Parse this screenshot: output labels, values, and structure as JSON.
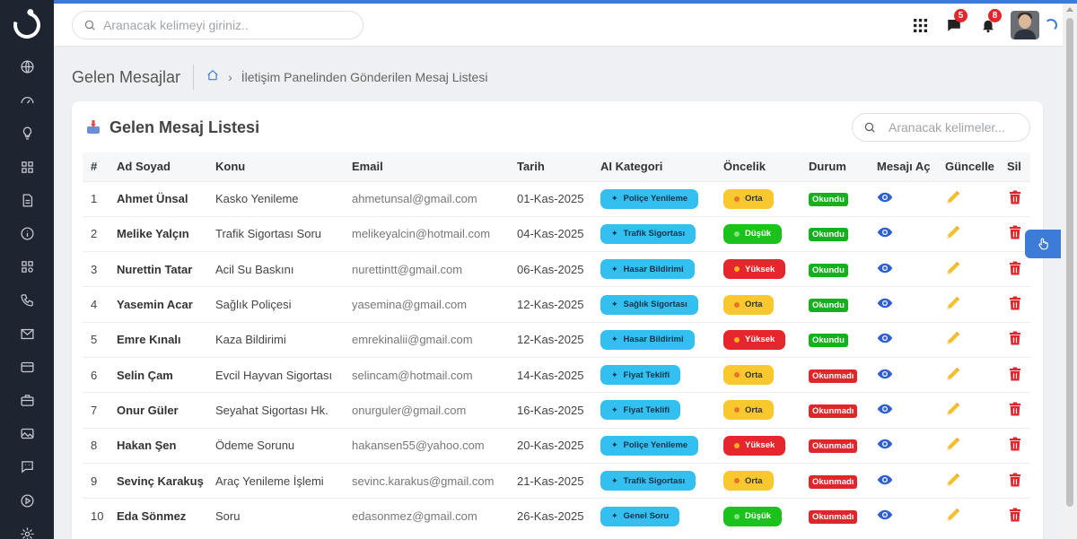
{
  "header": {
    "search_placeholder": "Aranacak kelimeyi giriniz..",
    "messages_count": "5",
    "notifications_count": "8"
  },
  "sidebar": {
    "items": [
      "globe-icon",
      "dashboard-icon",
      "lightbulb-icon",
      "grid-icon",
      "document-icon",
      "info-icon",
      "apps-icon",
      "phone-icon",
      "mail-icon",
      "card-icon",
      "briefcase-icon",
      "image-icon",
      "chat-icon",
      "play-icon",
      "settings-icon"
    ]
  },
  "page": {
    "title": "Gelen Mesajlar",
    "breadcrumb": "İletişim Panelinden Gönderilen Mesaj Listesi"
  },
  "card": {
    "title": "Gelen Mesaj Listesi",
    "search_placeholder": "Aranacak kelimeler...",
    "columns": [
      "#",
      "Ad Soyad",
      "Konu",
      "Email",
      "Tarih",
      "AI Kategori",
      "Öncelik",
      "Durum",
      "Mesajı Aç",
      "Güncelle",
      "Sil"
    ],
    "rows": [
      {
        "num": "1",
        "name": "Ahmet Ünsal",
        "subject": "Kasko Yenileme",
        "email": "ahmetunsal@gmail.com",
        "date": "01-Kas-2025",
        "category": "Poliçe Yenileme",
        "priority": "Orta",
        "status": "Okundu"
      },
      {
        "num": "2",
        "name": "Melike Yalçın",
        "subject": "Trafik Sigortası Soru",
        "email": "melikeyalcin@hotmail.com",
        "date": "04-Kas-2025",
        "category": "Trafik Sigortası",
        "priority": "Düşük",
        "status": "Okundu"
      },
      {
        "num": "3",
        "name": "Nurettin Tatar",
        "subject": "Acil Su Baskını",
        "email": "nurettintt@gmail.com",
        "date": "06-Kas-2025",
        "category": "Hasar Bildirimi",
        "priority": "Yüksek",
        "status": "Okundu"
      },
      {
        "num": "4",
        "name": "Yasemin Acar",
        "subject": "Sağlık Poliçesi",
        "email": "yasemina@gmail.com",
        "date": "12-Kas-2025",
        "category": "Sağlık Sigortası",
        "priority": "Orta",
        "status": "Okundu"
      },
      {
        "num": "5",
        "name": "Emre Kınalı",
        "subject": "Kaza Bildirimi",
        "email": "emrekinalii@gmail.com",
        "date": "12-Kas-2025",
        "category": "Hasar Bildirimi",
        "priority": "Yüksek",
        "status": "Okundu"
      },
      {
        "num": "6",
        "name": "Selin Çam",
        "subject": "Evcil Hayvan Sigortası",
        "email": "selincam@hotmail.com",
        "date": "14-Kas-2025",
        "category": "Fiyat Teklifi",
        "priority": "Orta",
        "status": "Okunmadı"
      },
      {
        "num": "7",
        "name": "Onur Güler",
        "subject": "Seyahat Sigortası Hk.",
        "email": "onurguler@gmail.com",
        "date": "16-Kas-2025",
        "category": "Fiyat Teklifi",
        "priority": "Orta",
        "status": "Okunmadı"
      },
      {
        "num": "8",
        "name": "Hakan Şen",
        "subject": "Ödeme Sorunu",
        "email": "hakansen55@yahoo.com",
        "date": "20-Kas-2025",
        "category": "Poliçe Yenileme",
        "priority": "Yüksek",
        "status": "Okunmadı"
      },
      {
        "num": "9",
        "name": "Sevinç Karakuş",
        "subject": "Araç Yenileme İşlemi",
        "email": "sevinc.karakus@gmail.com",
        "date": "21-Kas-2025",
        "category": "Trafik Sigortası",
        "priority": "Orta",
        "status": "Okunmadı"
      },
      {
        "num": "10",
        "name": "Eda Sönmez",
        "subject": "Soru",
        "email": "edasonmez@gmail.com",
        "date": "26-Kas-2025",
        "category": "Genel Soru",
        "priority": "Düşük",
        "status": "Okunmadı"
      }
    ]
  },
  "colors": {
    "accent": "#3d7bd9",
    "sidebar": "#1e2430",
    "category": "#33c0f0",
    "priority_orta": "#f9c82e",
    "priority_dusuk": "#1bc21b",
    "priority_yuksek": "#e5262c",
    "status_read": "#14b01d",
    "status_unread": "#e0262b"
  }
}
